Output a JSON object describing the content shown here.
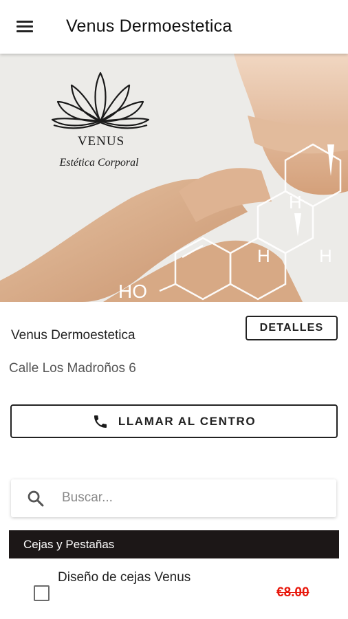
{
  "appbar": {
    "title": "Venus Dermoestetica",
    "menu_icon": "hamburger-menu-icon"
  },
  "hero": {
    "logo_name": "VENUS",
    "logo_tagline": "Estética Corporal",
    "molecule_labels": [
      "H",
      "H",
      "H",
      "HO"
    ],
    "colors": {
      "background": "#ececea",
      "skin": "#d9b08e",
      "lines": "#ffffff"
    }
  },
  "center": {
    "name": "Venus Dermoestetica",
    "details_label": "DETALLES",
    "address": "Calle Los Madroños 6",
    "call_label": "LLAMAR AL CENTRO",
    "call_icon": "phone-icon"
  },
  "search": {
    "placeholder": "Buscar...",
    "value": "",
    "icon": "search-icon"
  },
  "categories": [
    {
      "name": "Cejas y Pestañas",
      "services": [
        {
          "name": "Diseño de cejas Venus",
          "price": "€8.00",
          "checked": false
        }
      ]
    }
  ],
  "colors": {
    "category_bar": "#1c1717",
    "price": "#e8180c",
    "text": "#222222"
  }
}
